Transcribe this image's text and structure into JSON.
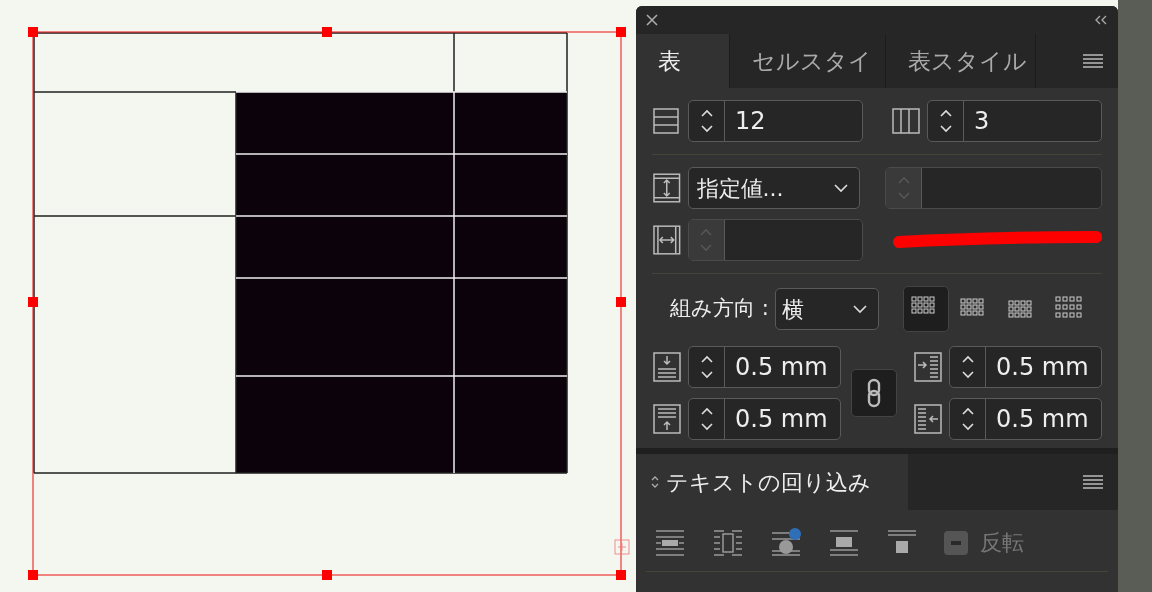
{
  "panel": {
    "tabs": [
      {
        "label": "表",
        "selected": true
      },
      {
        "label": "セルスタイ",
        "selected": false
      },
      {
        "label": "表スタイル",
        "selected": false
      }
    ],
    "rows_field": {
      "value": "12"
    },
    "columns_field": {
      "value": "3"
    },
    "row_height": {
      "mode": "指定値...",
      "disabled": true
    },
    "column_width": {
      "disabled": true
    },
    "direction": {
      "label": "組み方向 :",
      "value": "横"
    },
    "layout_options": [
      {
        "selected": true
      },
      {
        "selected": false
      },
      {
        "selected": false
      },
      {
        "selected": false
      }
    ],
    "insets": [
      {
        "kind": "top",
        "value": "0.5 mm"
      },
      {
        "kind": "left",
        "value": "0.5 mm"
      },
      {
        "kind": "bottom",
        "value": "0.5 mm"
      },
      {
        "kind": "right",
        "value": "0.5 mm"
      }
    ],
    "link_insets": {
      "on": true
    }
  },
  "wrap_panel": {
    "title": "テキストの回り込み",
    "invert": {
      "label": "反転",
      "disabled": true
    }
  }
}
